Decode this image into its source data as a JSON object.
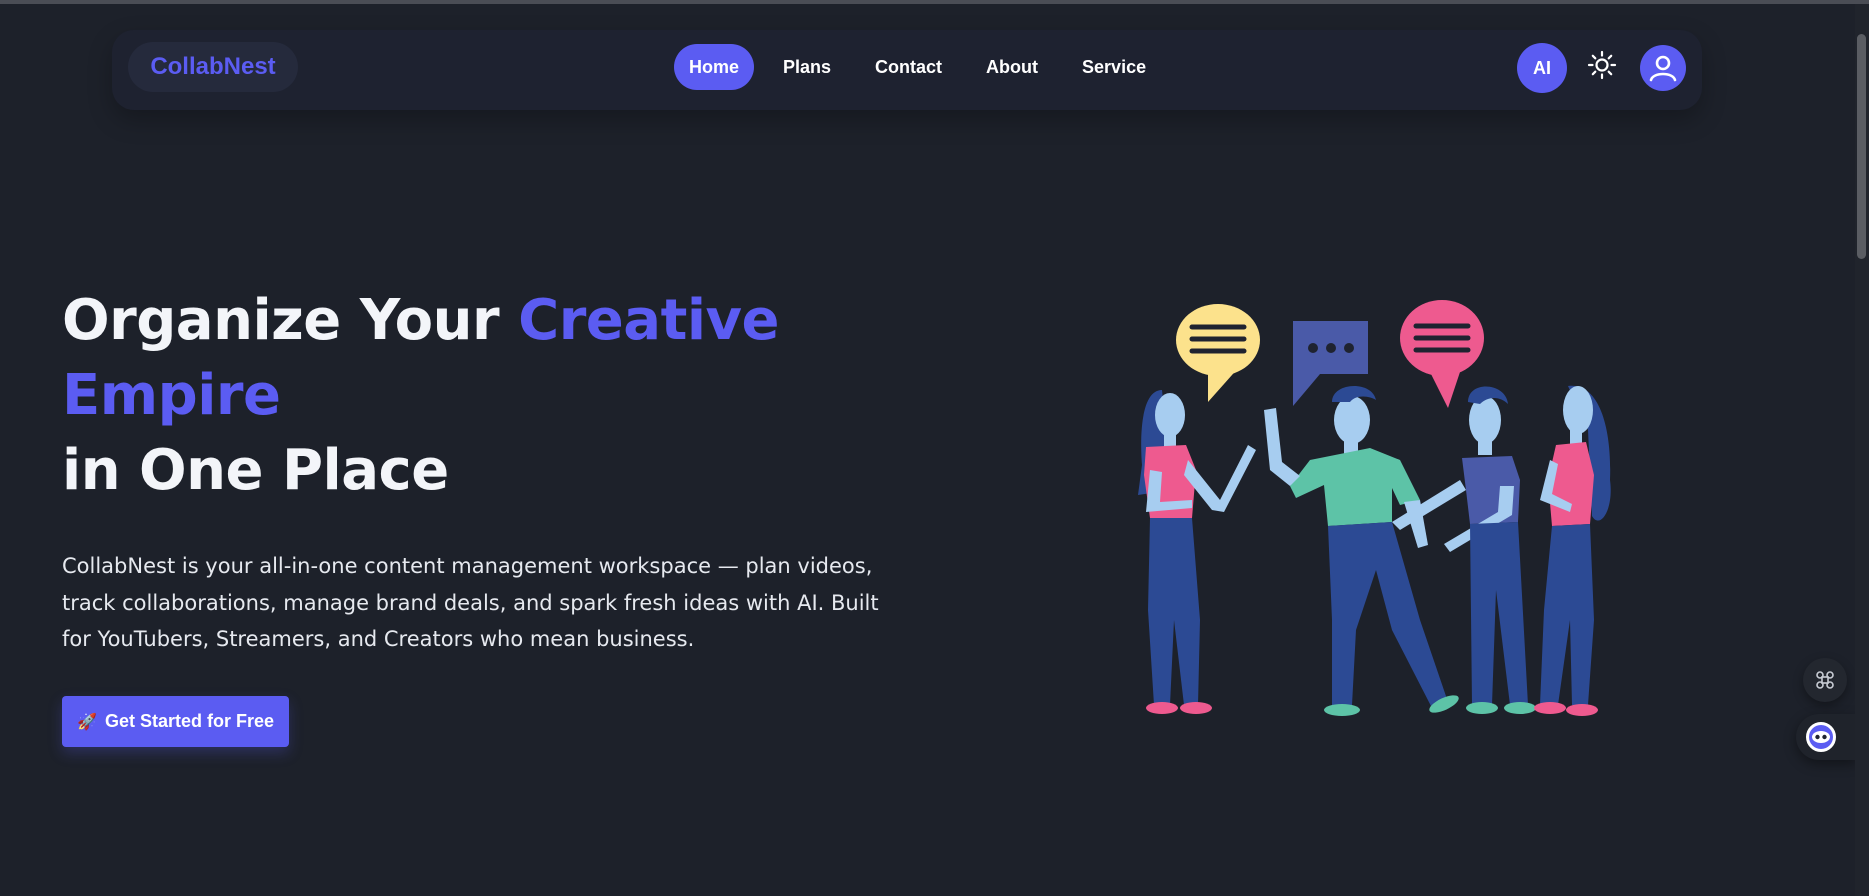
{
  "brand": {
    "logo": "CollabNest",
    "accent": "#5b5cf2",
    "background": "#1d212a"
  },
  "nav": {
    "items": [
      {
        "label": "Home",
        "active": true
      },
      {
        "label": "Plans",
        "active": false
      },
      {
        "label": "Contact",
        "active": false
      },
      {
        "label": "About",
        "active": false
      },
      {
        "label": "Service",
        "active": false
      }
    ],
    "ai_button": "AI",
    "theme_icon": "sun-icon",
    "profile_icon": "user-icon"
  },
  "hero": {
    "title_part1": "Organize Your ",
    "title_accent": "Creative Empire",
    "title_part2": "in One Place",
    "description": "CollabNest is your all-in-one content management workspace — plan videos, track collaborations, manage brand deals, and spark fresh ideas with AI. Built for YouTubers, Streamers, and Creators who mean business.",
    "cta_icon": "🚀",
    "cta_label": "Get Started for Free"
  },
  "widgets": {
    "command_icon": "command-icon",
    "chatbot_icon": "chatbot-icon"
  }
}
